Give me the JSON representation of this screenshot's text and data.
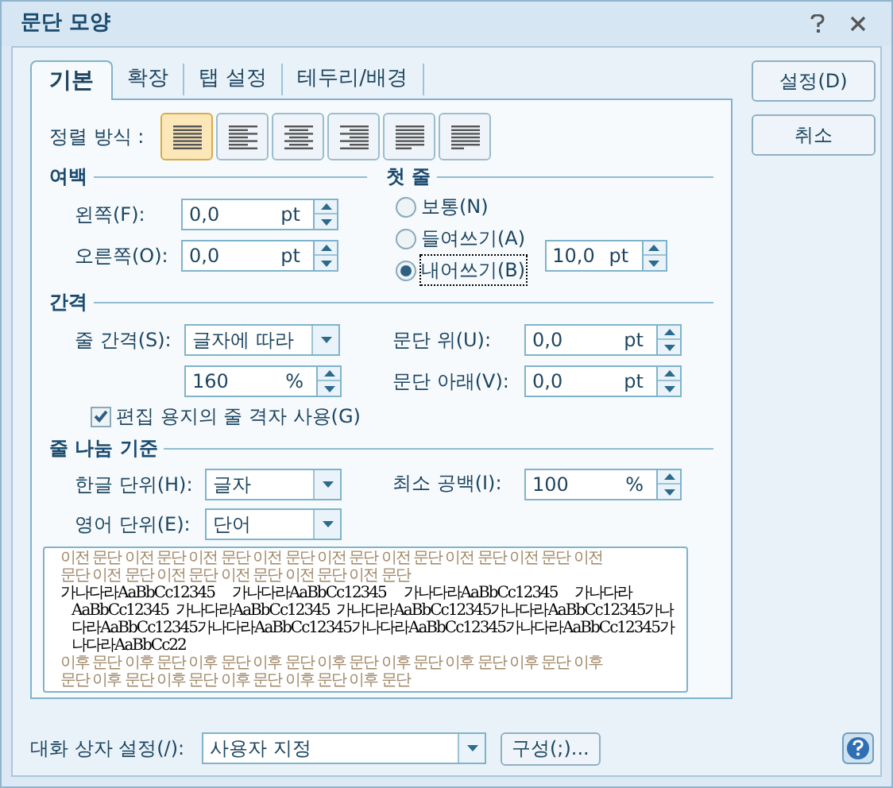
{
  "window": {
    "title": "문단 모양"
  },
  "tabs": [
    {
      "label": "기본",
      "selected": true
    },
    {
      "label": "확장",
      "selected": false
    },
    {
      "label": "탭 설정",
      "selected": false
    },
    {
      "label": "테두리/배경",
      "selected": false
    }
  ],
  "alignment": {
    "label": "정렬 방식 :",
    "options": [
      {
        "kind": "justify",
        "selected": true
      },
      {
        "kind": "left",
        "selected": false
      },
      {
        "kind": "center",
        "selected": false
      },
      {
        "kind": "right",
        "selected": false
      },
      {
        "kind": "distribute",
        "selected": false
      },
      {
        "kind": "divide",
        "selected": false
      }
    ]
  },
  "margins": {
    "title": "여백",
    "fields": [
      {
        "label": "왼쪽(F):",
        "value": "0,0",
        "unit": "pt"
      },
      {
        "label": "오른쪽(O):",
        "value": "0,0",
        "unit": "pt"
      }
    ]
  },
  "first_line": {
    "title": "첫 줄",
    "options": [
      {
        "label": "보통(N)",
        "selected": false
      },
      {
        "label": "들여쓰기(A)",
        "selected": false
      },
      {
        "label": "내어쓰기(B)",
        "selected": true
      }
    ],
    "field": {
      "value": "10,0",
      "unit": "pt"
    }
  },
  "spacing": {
    "title": "간격",
    "line_spacing": {
      "label": "줄 간격(S):",
      "dropdown": "글자에 따라",
      "value": "160",
      "unit": "%"
    },
    "before": {
      "label": "문단 위(U):",
      "value": "0,0",
      "unit": "pt"
    },
    "after": {
      "label": "문단 아래(V):",
      "value": "0,0",
      "unit": "pt"
    },
    "grid_checkbox": {
      "label": "편집 용지의 줄 격자 사용(G)",
      "checked": true
    }
  },
  "line_break": {
    "title": "줄 나눔 기준",
    "korean": {
      "label": "한글 단위(H):",
      "value": "글자"
    },
    "english": {
      "label": "영어 단위(E):",
      "value": "단어"
    },
    "min_space": {
      "label": "최소 공백(I):",
      "value": "100",
      "unit": "%"
    }
  },
  "preview": {
    "before_lines": [
      "이전 문단 이전 문단 이전 문단 이전 문단 이전 문단 이전 문단 이전 문단 이전 문단 이전",
      "문단 이전 문단 이전 문단 이전 문단 이전 문단 이전 문단"
    ],
    "sample_lines": [
      "가나다라AaBbCc12345     가나다라AaBbCc12345     가나다라AaBbCc12345     가나다라",
      "AaBbCc12345  가나다라AaBbCc12345  가나다라AaBbCc12345가나다라AaBbCc12345가나",
      "다라AaBbCc12345가나다라AaBbCc12345가나다라AaBbCc12345가나다라AaBbCc12345가",
      "나다라AaBbCc22"
    ],
    "after_lines": [
      "이후 문단 이후 문단 이후 문단 이후 문단 이후 문단 이후 문단 이후 문단 이후 문단 이후",
      "문단 이후 문단 이후 문단 이후 문단 이후 문단 이후 문단"
    ]
  },
  "buttons": [
    {
      "label": "설정(D)"
    },
    {
      "label": "취소"
    }
  ],
  "footer": {
    "label": "대화 상자 설정(/):",
    "dropdown": "사용자 지정",
    "button": "구성(;)..."
  }
}
